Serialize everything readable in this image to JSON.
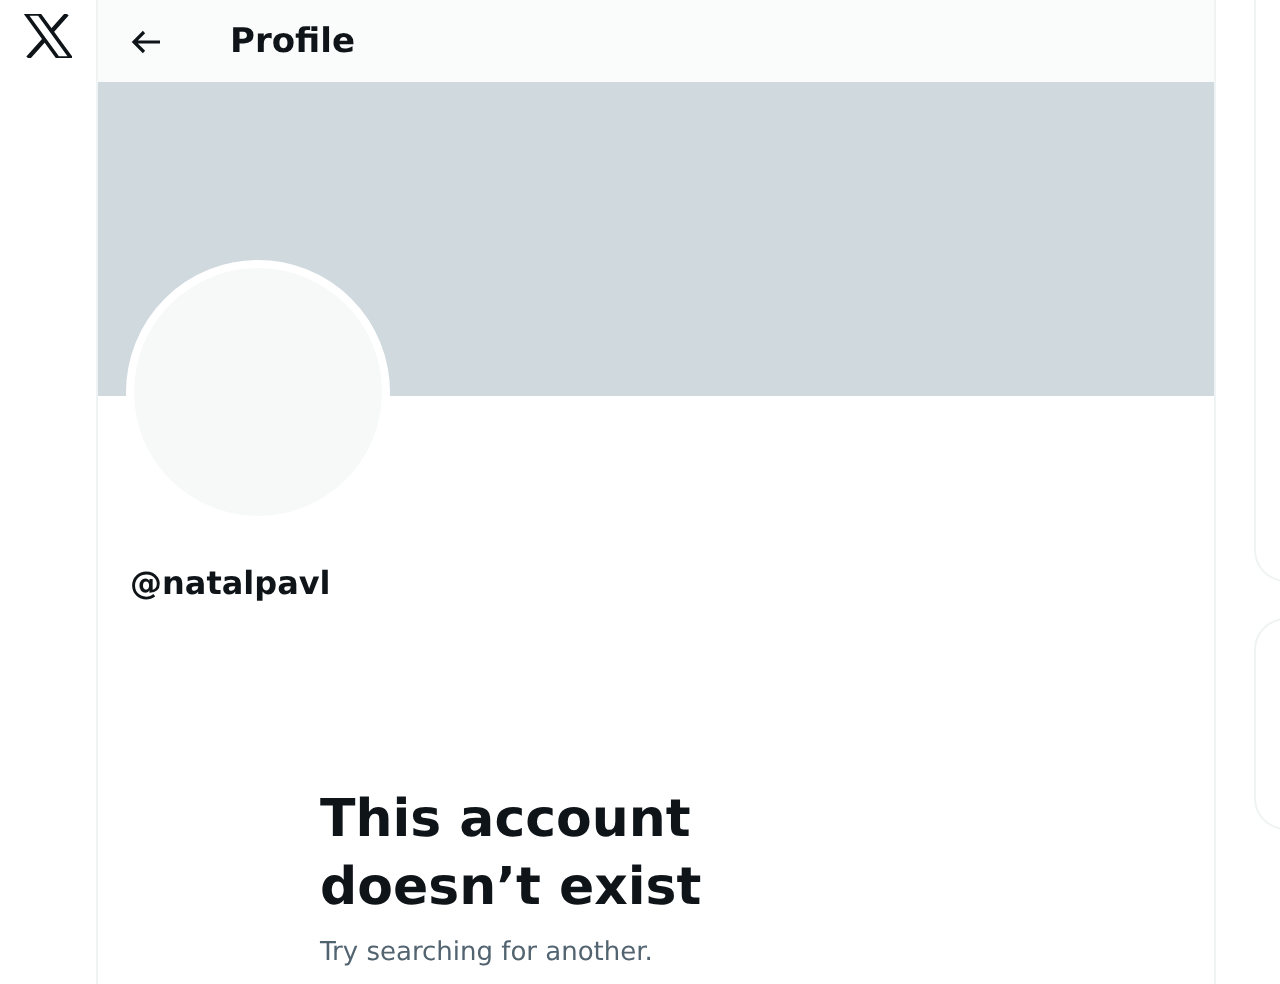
{
  "header": {
    "title": "Profile"
  },
  "profile": {
    "handle": "@natalpavl"
  },
  "empty_state": {
    "title": "This account doesn’t exist",
    "subtitle": "Try searching for another."
  }
}
